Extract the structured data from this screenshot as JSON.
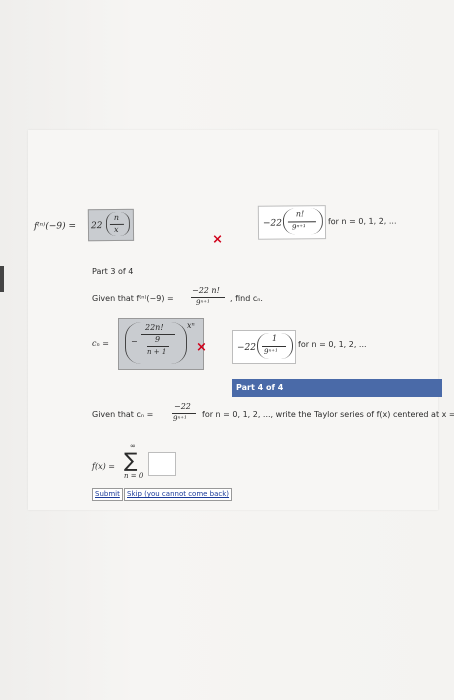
{
  "part2": {
    "lhs": "f⁽ⁿ⁾(−9) =",
    "entered_coef": "22",
    "entered_frac_num": "n",
    "entered_frac_den": "x",
    "correct_coef": "−22",
    "correct_frac_num": "n!",
    "correct_frac_den": "9ⁿ⁺¹",
    "range_text": "for n = 0, 1, 2, ..."
  },
  "part3": {
    "title": "Part 3 of 4",
    "given_prefix": "Given that f⁽ⁿ⁾(−9) =",
    "given_num": "−22 n!",
    "given_den": "9ⁿ⁺¹",
    "given_suffix": ", find cₙ.",
    "cn_label": "cₙ =",
    "entered_num": "22n!",
    "entered_inner_num": "9",
    "entered_inner_den": "n + 1",
    "entered_power": "xⁿ",
    "correct_coef": "−22",
    "correct_num": "1",
    "correct_den": "9ⁿ⁺¹",
    "range_text": "for n = 0, 1, 2, ..."
  },
  "part4": {
    "title": "Part 4 of 4",
    "given_prefix": "Given that cₙ =",
    "given_num": "−22",
    "given_den": "9ⁿ⁺¹",
    "given_suffix": "for n = 0, 1, 2, ..., write the Taylor series of f(x) centered at x = −9.",
    "fx_label": "f(x) =",
    "sum_upper": "∞",
    "sum_lower": "n = 0",
    "sum_symbol": "∑",
    "answer_value": ""
  },
  "buttons": {
    "submit": "Submit",
    "skip": "Skip (you cannot come back)"
  },
  "icons": {
    "wrong_mark": "×"
  },
  "colors": {
    "header": "#4a6aa8",
    "wrong": "#d0021b"
  }
}
